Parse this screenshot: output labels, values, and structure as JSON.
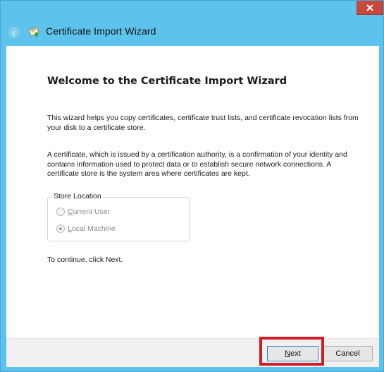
{
  "window": {
    "title": "Certificate Import Wizard"
  },
  "main": {
    "heading": "Welcome to the Certificate Import Wizard",
    "paragraph1": "This wizard helps you copy certificates, certificate trust lists, and certificate revocation lists from your disk to a certificate store.",
    "paragraph2": "A certificate, which is issued by a certification authority, is a confirmation of your identity and contains information used to protect data or to establish secure network connections. A certificate store is the system area where certificates are kept.",
    "store_location": {
      "legend": "Store Location",
      "options": [
        {
          "label_first": "C",
          "label_rest": "urrent User",
          "selected": false,
          "enabled": false
        },
        {
          "label_first": "L",
          "label_rest": "ocal Machine",
          "selected": true,
          "enabled": false
        }
      ]
    },
    "continue_text": "To continue, click Next."
  },
  "footer": {
    "next_first": "N",
    "next_rest": "ext",
    "cancel_label": "Cancel"
  },
  "colors": {
    "titlebar": "#5ec3ec",
    "close": "#c7483c",
    "highlight": "#d01c24"
  },
  "icons": [
    "close-icon",
    "back-arrow-icon",
    "certificate-icon"
  ]
}
